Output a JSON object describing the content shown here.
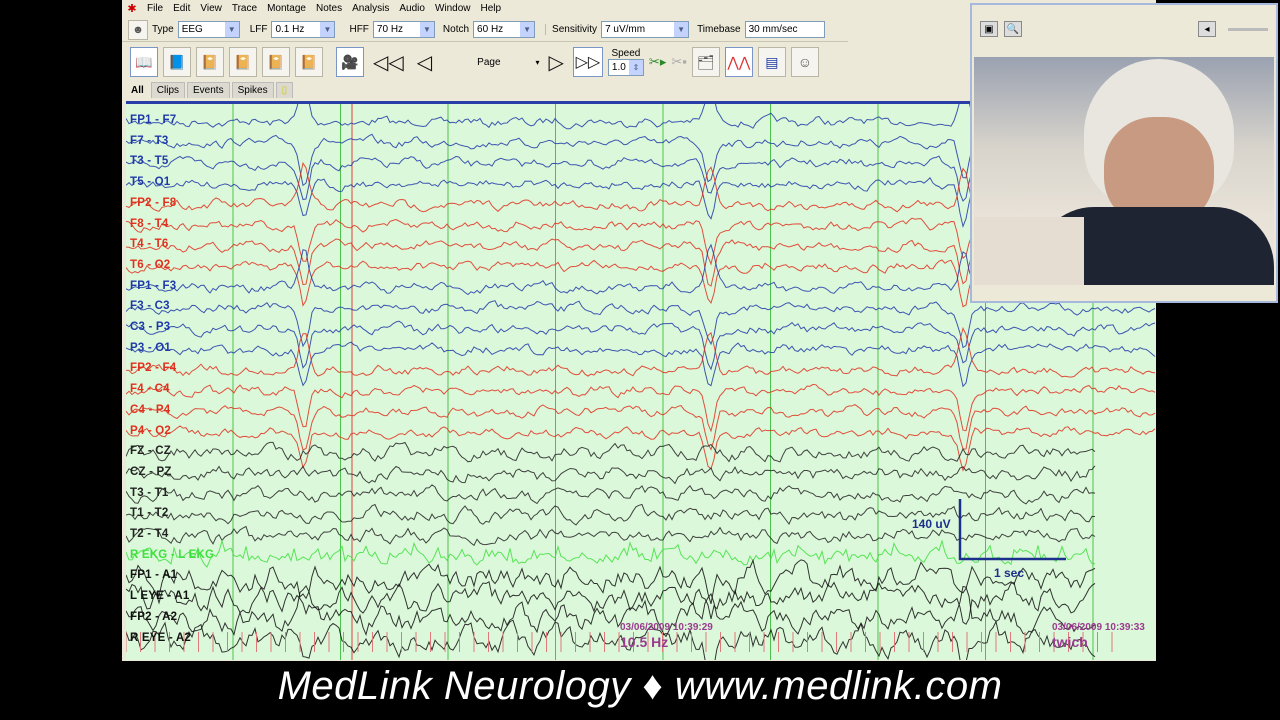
{
  "menu": [
    "File",
    "Edit",
    "View",
    "Trace",
    "Montage",
    "Notes",
    "Analysis",
    "Audio",
    "Window",
    "Help"
  ],
  "toolbar": {
    "type_label": "Type",
    "type_value": "EEG",
    "lff_label": "LFF",
    "lff_value": "0.1 Hz",
    "hff_label": "HFF",
    "hff_value": "70 Hz",
    "notch_label": "Notch",
    "notch_value": "60 Hz",
    "sensitivity_label": "Sensitivity",
    "sensitivity_value": "7 uV/mm",
    "timebase_label": "Timebase",
    "timebase_value": "30 mm/sec",
    "page_label": "Page",
    "speed_label": "Speed",
    "speed_value": "1.0"
  },
  "tabs": [
    "All",
    "Clips",
    "Events",
    "Spikes"
  ],
  "channels": [
    {
      "label": "FP1 - F7",
      "color": "#1f3aa8"
    },
    {
      "label": "F7 - T3",
      "color": "#1f3aa8"
    },
    {
      "label": "T3 - T5",
      "color": "#1f3aa8"
    },
    {
      "label": "T5 - O1",
      "color": "#1f3aa8"
    },
    {
      "label": "FP2 - F8",
      "color": "#e0301e"
    },
    {
      "label": "F8 - T4",
      "color": "#e0301e"
    },
    {
      "label": "T4 - T6",
      "color": "#e0301e"
    },
    {
      "label": "T6 - O2",
      "color": "#e0301e"
    },
    {
      "label": "FP1 - F3",
      "color": "#1f3aa8"
    },
    {
      "label": "F3 - C3",
      "color": "#1f3aa8"
    },
    {
      "label": "C3 - P3",
      "color": "#1f3aa8"
    },
    {
      "label": "P3 - O1",
      "color": "#1f3aa8"
    },
    {
      "label": "FP2 - F4",
      "color": "#e0301e"
    },
    {
      "label": "F4 - C4",
      "color": "#e0301e"
    },
    {
      "label": "C4 - P4",
      "color": "#e0301e"
    },
    {
      "label": "P4 - O2",
      "color": "#e0301e"
    },
    {
      "label": "FZ - CZ",
      "color": "#222222"
    },
    {
      "label": "CZ - PZ",
      "color": "#222222"
    },
    {
      "label": "T3 - T1",
      "color": "#222222"
    },
    {
      "label": "T1 - T2",
      "color": "#222222"
    },
    {
      "label": "T2 - T4",
      "color": "#222222"
    },
    {
      "label": "R EKG - L EKG",
      "color": "#3ee03e"
    },
    {
      "label": "FP1 - A1",
      "color": "#111111"
    },
    {
      "label": "L EYE - A1",
      "color": "#111111"
    },
    {
      "label": "FP2 - A2",
      "color": "#111111"
    },
    {
      "label": "R EYE - A2",
      "color": "#111111"
    }
  ],
  "annotations": {
    "ts1": "03/06/2009 10:39:29",
    "note1": "10.5 Hz",
    "ts2": "03/06/2009 10:39:33",
    "note2": "twich",
    "scale_amp": "140 uV",
    "scale_time": "1 sec"
  },
  "caption": "MedLink Neurology ♦ www.medlink.com"
}
